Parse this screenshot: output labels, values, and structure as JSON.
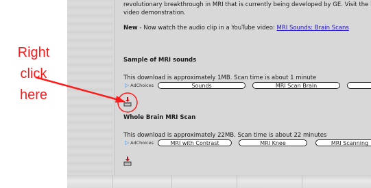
{
  "annotation": {
    "lines": [
      "Right",
      "click",
      "here"
    ],
    "color": "#ff1a1a"
  },
  "content": {
    "intro_line1": "revolutionary breakthrough in MRI that is currently being developed by GE.  Visit the lin",
    "intro_line2": "video demonstration.",
    "new_label": "New",
    "new_text": " -  Now watch the audio clip in a YouTube video: ",
    "new_link": "MRI Sounds: Brain Scans",
    "section1": {
      "heading": "Sample of MRI sounds",
      "desc": "This download is approximately 1MB.  Scan time is about 1 minute",
      "adchoices": "AdChoices",
      "buttons": [
        "Sounds",
        "MRI Scan Brain",
        ""
      ]
    },
    "section2": {
      "heading": "Whole Brain MRI Scan",
      "desc": "This download is approximately 22MB.  Scan time is about 22 minutes",
      "adchoices": "AdChoices",
      "buttons": [
        "MRI with Contrast",
        "MRI Knee",
        "MRI Scanning"
      ]
    }
  },
  "icons": {
    "download": "download-icon",
    "adchoices": "adchoices-icon"
  }
}
